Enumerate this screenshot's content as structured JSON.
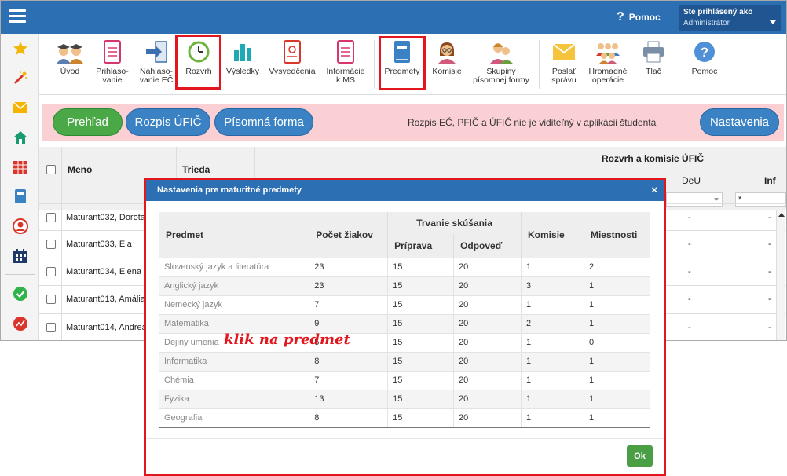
{
  "header": {
    "help_label": "Pomoc",
    "user_line1": "Ste prihlásený ako",
    "user_line2": "Administrátor"
  },
  "toolbar": [
    {
      "key": "uvod",
      "label": "Úvod"
    },
    {
      "key": "prihlasovanie",
      "label": "Prihlaso-\nvanie"
    },
    {
      "key": "nahlasovanie",
      "label": "Nahlaso-\nvanie EČ"
    },
    {
      "key": "rozvrh",
      "label": "Rozvrh"
    },
    {
      "key": "vysledky",
      "label": "Výsledky"
    },
    {
      "key": "vysvedcenia",
      "label": "Vysvedčenia"
    },
    {
      "key": "informacie",
      "label": "Informácie\nk MS"
    },
    {
      "key": "predmety",
      "label": "Predmety"
    },
    {
      "key": "komisie",
      "label": "Komisie"
    },
    {
      "key": "skupiny",
      "label": "Skupiny\npísomnej formy"
    },
    {
      "key": "poslat",
      "label": "Poslať\nsprávu"
    },
    {
      "key": "hromadne",
      "label": "Hromadné\noperácie"
    },
    {
      "key": "tlac",
      "label": "Tlač"
    },
    {
      "key": "pomoc",
      "label": "Pomoc"
    }
  ],
  "banner": {
    "tab_prehlad": "Prehľad",
    "tab_rozpis": "Rozpis ÚFIČ",
    "tab_pisomna": "Písomná forma",
    "note": "Rozpis EČ, PFIČ a ÚFIČ nie je viditeľný v aplikácii študenta",
    "settings": "Nastavenia"
  },
  "grid": {
    "col_name": "Meno",
    "col_class": "Trieda",
    "group_header": "Rozvrh a komisie ÚFIČ",
    "col_deu": "DeU",
    "col_inf": "Inf",
    "filter_inf": "*",
    "rows": [
      {
        "name": "Maturant032, Dorota",
        "deu": "-",
        "inf": "-"
      },
      {
        "name": "Maturant033, Ela",
        "deu": "-",
        "inf": "-"
      },
      {
        "name": "Maturant034, Elena",
        "deu": "-",
        "inf": "-"
      },
      {
        "name": "Maturant013, Amália",
        "deu": "-",
        "inf": "-"
      },
      {
        "name": "Maturant014, Andrea",
        "deu": "-",
        "inf": "-"
      }
    ]
  },
  "modal": {
    "title": "Nastavenia pre maturitné predmety",
    "close": "×",
    "h_predmet": "Predmet",
    "h_pocet": "Počet žiakov",
    "h_trvanie": "Trvanie skúšania",
    "h_priprava": "Príprava",
    "h_odpoved": "Odpoveď",
    "h_komisie": "Komisie",
    "h_miestnosti": "Miestnosti",
    "rows": [
      {
        "predmet": "Slovenský jazyk a literatúra",
        "pocet": "23",
        "priprava": "15",
        "odpoved": "20",
        "komisie": "1",
        "miestnosti": "2"
      },
      {
        "predmet": "Anglický jazyk",
        "pocet": "23",
        "priprava": "15",
        "odpoved": "20",
        "komisie": "3",
        "miestnosti": "1"
      },
      {
        "predmet": "Nemecký jazyk",
        "pocet": "7",
        "priprava": "15",
        "odpoved": "20",
        "komisie": "1",
        "miestnosti": "1"
      },
      {
        "predmet": "Matematika",
        "pocet": "9",
        "priprava": "15",
        "odpoved": "20",
        "komisie": "2",
        "miestnosti": "1"
      },
      {
        "predmet": "Dejiny umenia",
        "pocet": "5",
        "priprava": "15",
        "odpoved": "20",
        "komisie": "1",
        "miestnosti": "0"
      },
      {
        "predmet": "Informatika",
        "pocet": "8",
        "priprava": "15",
        "odpoved": "20",
        "komisie": "1",
        "miestnosti": "1"
      },
      {
        "predmet": "Chémia",
        "pocet": "7",
        "priprava": "15",
        "odpoved": "20",
        "komisie": "1",
        "miestnosti": "1"
      },
      {
        "predmet": "Fyzika",
        "pocet": "13",
        "priprava": "15",
        "odpoved": "20",
        "komisie": "1",
        "miestnosti": "1"
      },
      {
        "predmet": "Geografia",
        "pocet": "8",
        "priprava": "15",
        "odpoved": "20",
        "komisie": "1",
        "miestnosti": "1"
      }
    ],
    "ok": "Ok",
    "annotation": "klik na predmet"
  },
  "colors": {
    "header_blue": "#2c6fb3",
    "green_pill": "#4aa847",
    "blue_pill": "#3b82c4",
    "highlight_red": "#e2171e",
    "banner_pink": "#fbd0d4"
  }
}
